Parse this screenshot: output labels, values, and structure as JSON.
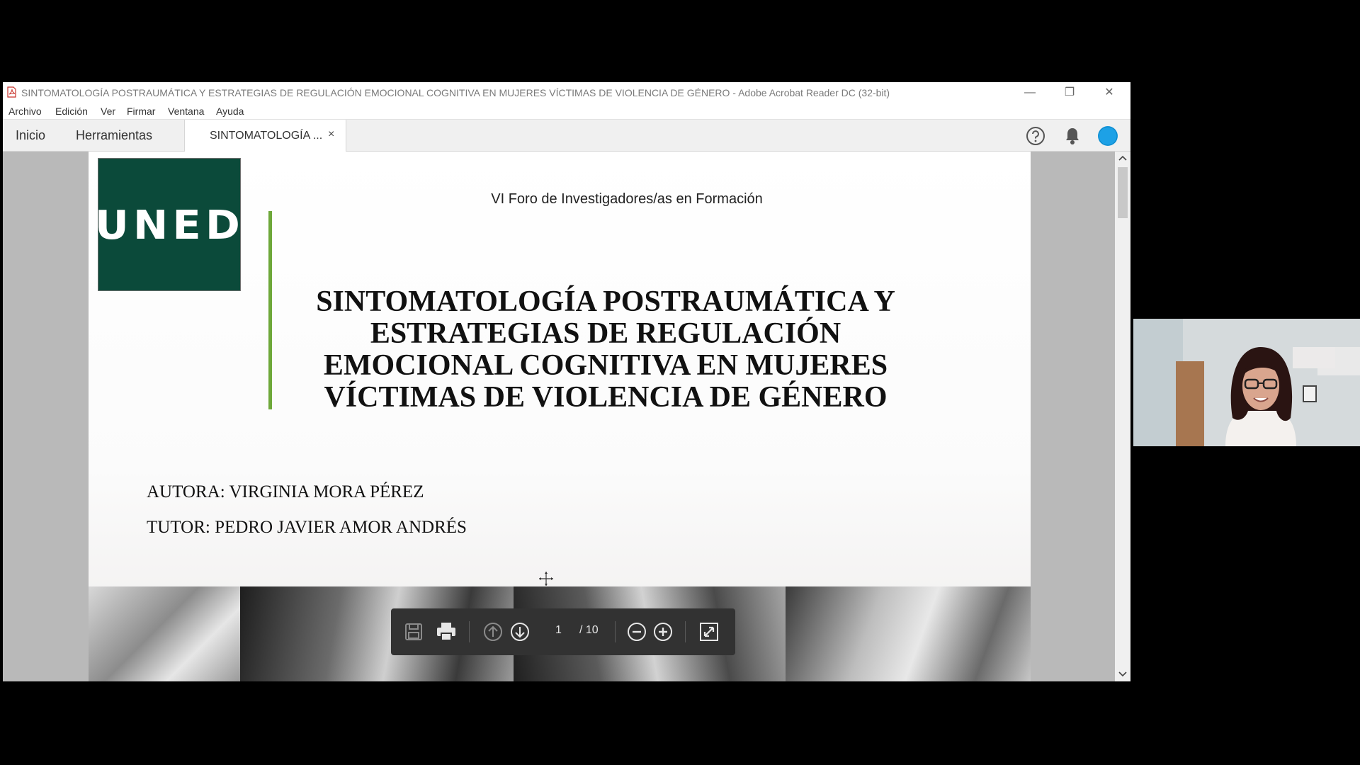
{
  "window": {
    "title": "SINTOMATOLOGÍA POSTRAUMÁTICA Y ESTRATEGIAS DE REGULACIÓN EMOCIONAL COGNITIVA EN MUJERES VÍCTIMAS DE VIOLENCIA DE GÉNERO - Adobe Acrobat Reader DC (32-bit)"
  },
  "menu": {
    "items": [
      "Archivo",
      "Edición",
      "Ver",
      "Firmar",
      "Ventana",
      "Ayuda"
    ]
  },
  "tabs": {
    "home": "Inicio",
    "tools": "Herramientas",
    "document": "SINTOMATOLOGÍA ...",
    "close_symbol": "×"
  },
  "header_icons": [
    "help-icon",
    "notifications-bell-icon",
    "account-avatar-icon"
  ],
  "document": {
    "logo_text": "UNED",
    "forum": "VI Foro de Investigadores/as en Formación",
    "title_lines": [
      "SINTOMATOLOGÍA POSTRAUMÁTICA Y",
      "ESTRATEGIAS DE REGULACIÓN",
      "EMOCIONAL COGNITIVA EN MUJERES",
      "VÍCTIMAS DE VIOLENCIA DE GÉNERO"
    ],
    "author": "AUTORA: VIRGINIA MORA PÉREZ",
    "tutor": "TUTOR: PEDRO JAVIER AMOR ANDRÉS"
  },
  "toolbar": {
    "current_page": "1",
    "total_pages": "/ 10"
  },
  "colors": {
    "uned_green": "#0b4a3a",
    "accent_bar": "#6ea83a",
    "toolbar_bg": "#323232"
  }
}
